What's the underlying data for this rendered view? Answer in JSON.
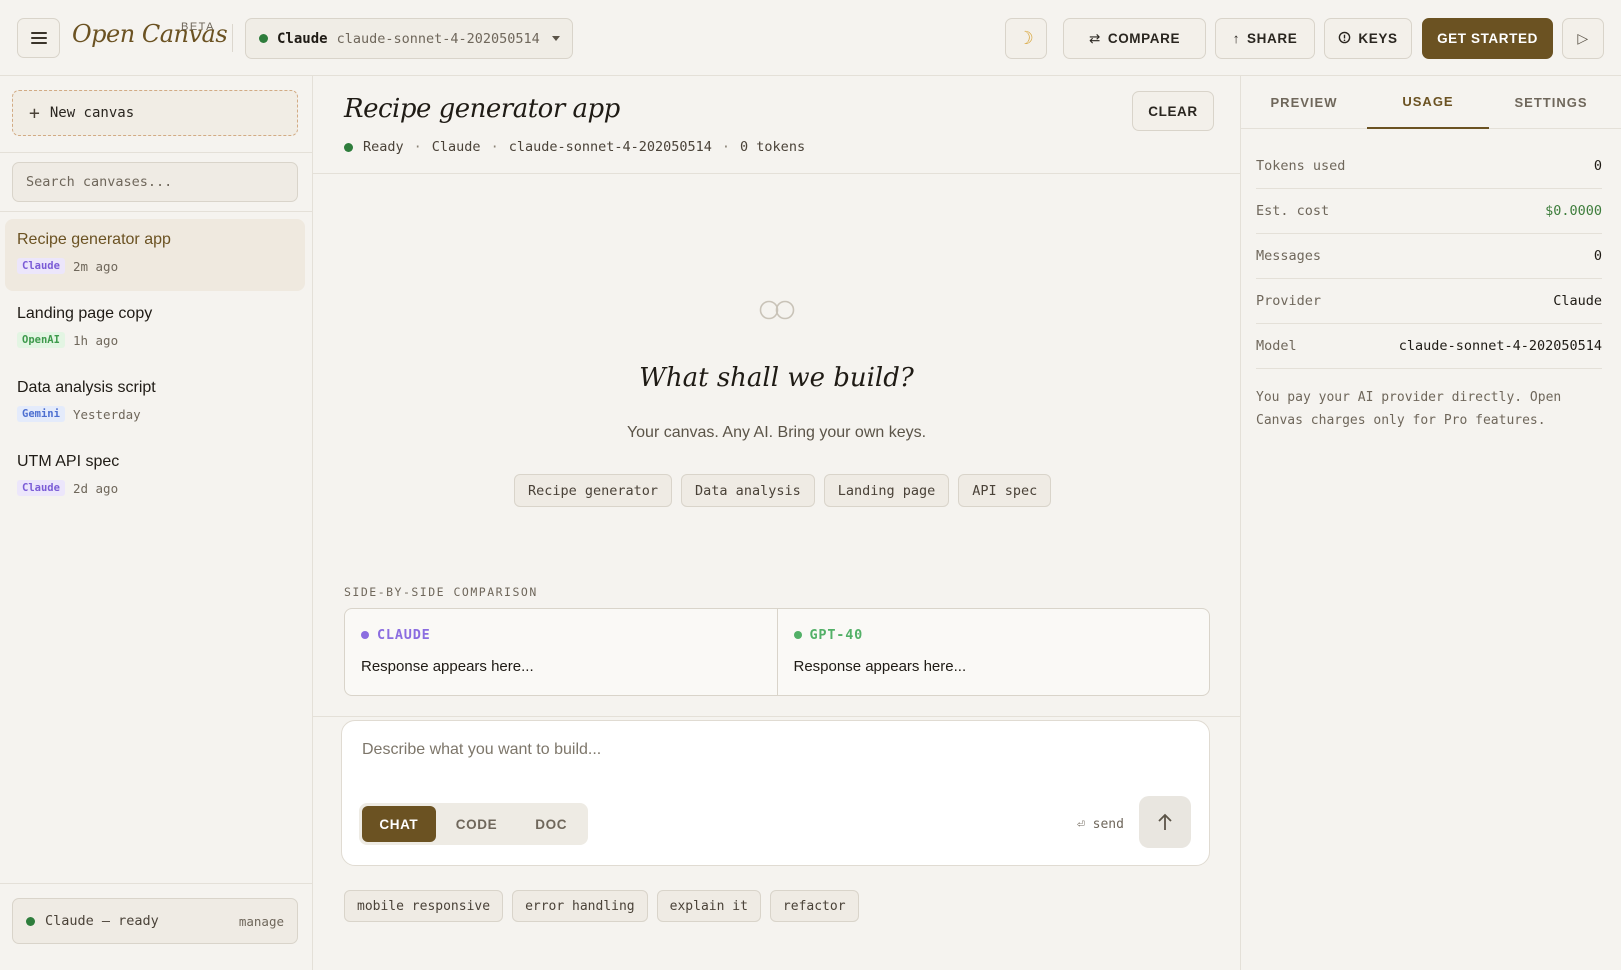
{
  "header": {
    "brand": "Open Canvas",
    "badge": "BETA",
    "model_select": {
      "provider": "Claude",
      "model": "claude-sonnet-4-202050514"
    },
    "buttons": {
      "compare": "COMPARE",
      "share": "SHARE",
      "keys": "KEYS",
      "get_started": "GET STARTED"
    },
    "icons": {
      "menu": "hamburger-icon",
      "theme": "moon-icon",
      "compare": "swap-arrows-icon",
      "share": "arrow-up-icon",
      "keys": "key-circle-icon",
      "run": "play-icon"
    }
  },
  "sidebar": {
    "new_canvas": "New canvas",
    "search_placeholder": "Search canvases...",
    "items": [
      {
        "title": "Recipe generator app",
        "tag": "Claude",
        "time": "2m ago",
        "active": true
      },
      {
        "title": "Landing page copy",
        "tag": "OpenAI",
        "time": "1h ago"
      },
      {
        "title": "Data analysis script",
        "tag": "Gemini",
        "time": "Yesterday"
      },
      {
        "title": "UTM API spec",
        "tag": "Claude",
        "time": "2d ago"
      }
    ],
    "footer": {
      "status": "Claude — ready",
      "manage": "manage"
    }
  },
  "main": {
    "title": "Recipe generator app",
    "status": {
      "state": "Ready",
      "provider": "Claude",
      "model": "claude-sonnet-4-202050514",
      "tokens": "0 tokens"
    },
    "clear": "CLEAR",
    "empty": {
      "heading": "What shall we build?",
      "subheading": "Your canvas. Any AI. Bring your own keys.",
      "starters": [
        "Recipe generator",
        "Data analysis",
        "Landing page",
        "API spec"
      ]
    },
    "comparison": {
      "label": "SIDE-BY-SIDE COMPARISON",
      "left": {
        "name": "CLAUDE",
        "response": "Response appears here..."
      },
      "right": {
        "name": "GPT-40",
        "response": "Response appears here..."
      }
    },
    "composer": {
      "placeholder": "Describe what you want to build...",
      "modes": [
        "CHAT",
        "CODE",
        "DOC"
      ],
      "active_mode": "CHAT",
      "send_hint": "send"
    },
    "suggestions": [
      "mobile responsive",
      "error handling",
      "explain it",
      "refactor"
    ]
  },
  "right_panel": {
    "tabs": [
      "PREVIEW",
      "USAGE",
      "SETTINGS"
    ],
    "active_tab": "USAGE",
    "stats": [
      {
        "label": "Tokens used",
        "value": "0"
      },
      {
        "label": "Est. cost",
        "value": "$0.0000"
      },
      {
        "label": "Messages",
        "value": "0"
      },
      {
        "label": "Provider",
        "value": "Claude"
      },
      {
        "label": "Model",
        "value": "claude-sonnet-4-202050514"
      }
    ],
    "note": "You pay your AI provider directly. Open Canvas charges only for Pro features."
  },
  "colors": {
    "accent": "#6b5222",
    "background": "#f5f3ef",
    "ready": "#2e7d3c",
    "claude": "#8b6de0",
    "gpt": "#52b067"
  }
}
